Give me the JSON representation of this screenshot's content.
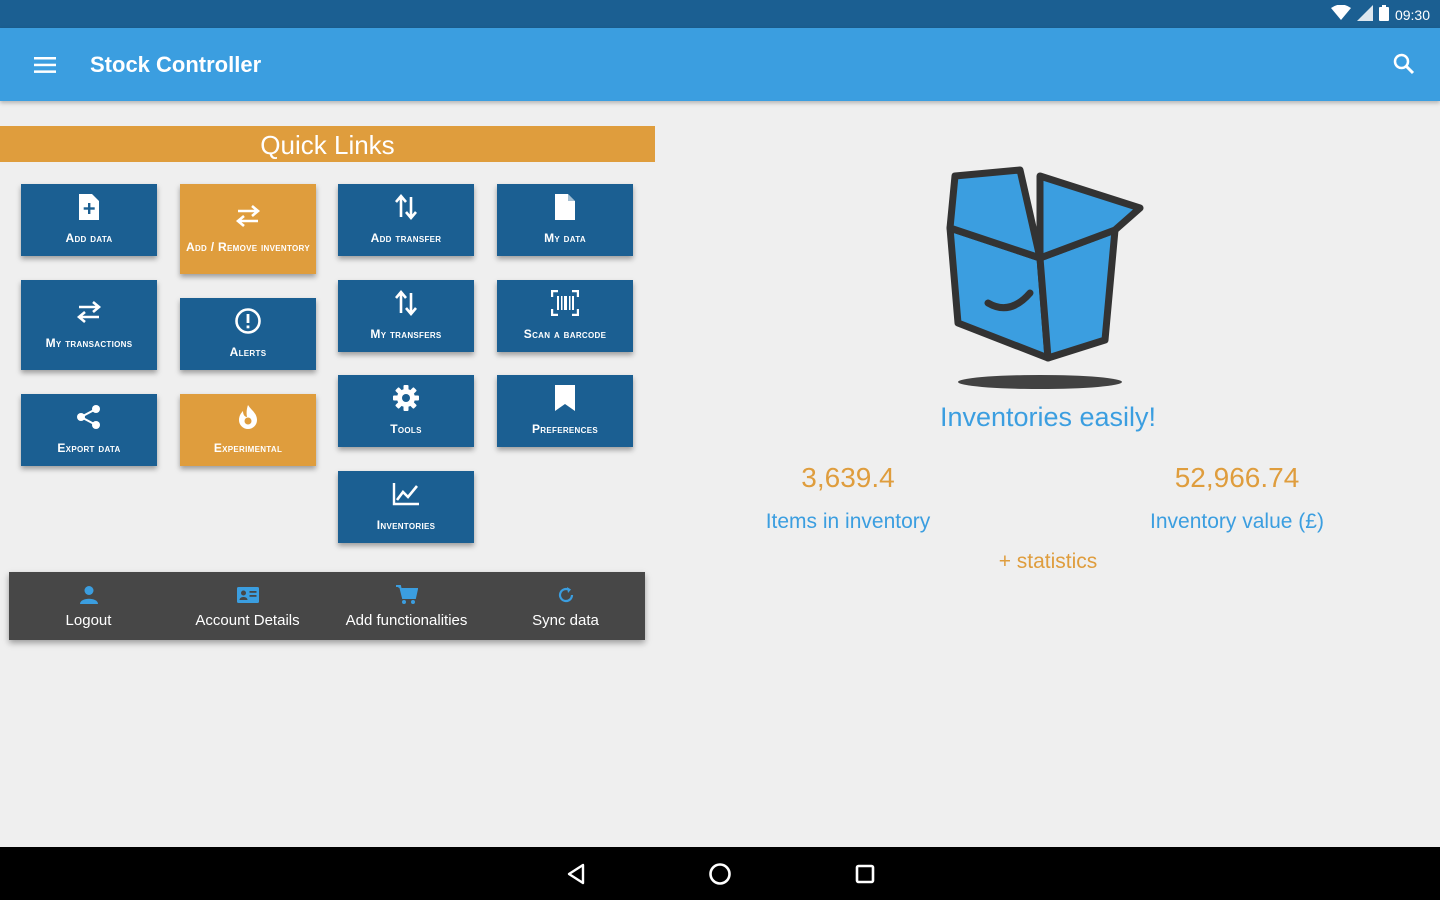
{
  "status": {
    "time": "09:30"
  },
  "appbar": {
    "title": "Stock Controller"
  },
  "quick_links": {
    "title": "Quick Links",
    "tiles": {
      "add_data": "Add data",
      "add_remove_inventory": "Add / Remove inventory",
      "add_transfer": "Add transfer",
      "my_data": "My data",
      "my_transactions": "My transactions",
      "alerts": "Alerts",
      "my_transfers": "My transfers",
      "scan_barcode": "Scan a barcode",
      "export_data": "Export data",
      "experimental": "Experimental",
      "tools": "Tools",
      "preferences": "Preferences",
      "inventories": "Inventories"
    }
  },
  "bottom_nav": {
    "logout": "Logout",
    "account_details": "Account Details",
    "add_functionalities": "Add functionalities",
    "sync_data": "Sync data"
  },
  "dashboard": {
    "tagline": "Inventories easily!",
    "items_value": "3,639.4",
    "items_label": "Items in inventory",
    "inventory_value": "52,966.74",
    "inventory_value_label": "Inventory value (£)",
    "statistics_link": "+ statistics"
  },
  "colors": {
    "status_bar": "#1b5f92",
    "app_bar": "#3b9ee0",
    "tile_blue": "#1b5f92",
    "tile_orange": "#df9d3d",
    "bottom_nav": "#474747",
    "accent_text_blue": "#3b9ee0",
    "accent_text_orange": "#df9d3d"
  },
  "icons": {
    "add_data": "file-plus-icon",
    "add_remove_inventory": "swap-horizontal-icon",
    "add_transfer": "swap-vertical-icon",
    "my_data": "file-icon",
    "my_transactions": "swap-horizontal-icon",
    "alerts": "alert-circle-icon",
    "my_transfers": "swap-vertical-icon",
    "scan_barcode": "barcode-scan-icon",
    "export_data": "share-icon",
    "experimental": "fire-icon",
    "tools": "gear-icon",
    "preferences": "bookmark-icon",
    "inventories": "line-chart-icon"
  }
}
